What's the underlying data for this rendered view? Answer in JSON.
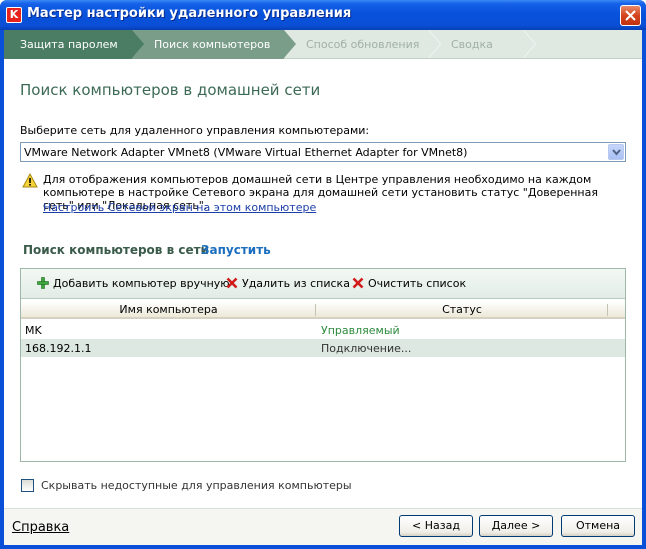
{
  "window": {
    "title": "Мастер настройки удаленного управления",
    "app_icon_letter": "K",
    "accent_color": "#0a4fd8"
  },
  "steps": [
    {
      "label": "Защита паролем",
      "state": "done"
    },
    {
      "label": "Поиск компьютеров",
      "state": "active"
    },
    {
      "label": "Способ обновления",
      "state": "future"
    },
    {
      "label": "Сводка",
      "state": "future"
    }
  ],
  "page": {
    "title": "Поиск компьютеров в домашней сети",
    "network_label": "Выберите сеть для удаленного управления компьютерами:",
    "network_selected": "VMware Network Adapter VMnet8 (VMware Virtual Ethernet Adapter for VMnet8)",
    "warning_text": "Для отображения компьютеров домашней сети в Центре управления необходимо на каждом компьютере в настройке Сетевого экрана для домашней сети установить статус \"Доверенная сеть\" или \"Локальная сеть\".",
    "warning_link": "Настроить Сетевой экран на этом компьютере",
    "search_label": "Поиск компьютеров в сети",
    "search_run": "Запустить"
  },
  "toolbar": {
    "add_label": "Добавить компьютер вручную",
    "delete_label": "Удалить из списка",
    "clear_label": "Очистить список"
  },
  "table": {
    "columns": [
      "Имя компьютера",
      "Статус"
    ],
    "rows": [
      {
        "name": "MK",
        "status": "Управляемый"
      },
      {
        "name": "168.192.1.1",
        "status": "Подключение..."
      }
    ]
  },
  "options": {
    "hide_unavailable_label": "Скрывать недоступные для управления компьютеры",
    "hide_unavailable_checked": false
  },
  "footer": {
    "help_label": "Справка",
    "back_label": "< Назад",
    "next_label": "Далее >",
    "cancel_label": "Отмена"
  }
}
